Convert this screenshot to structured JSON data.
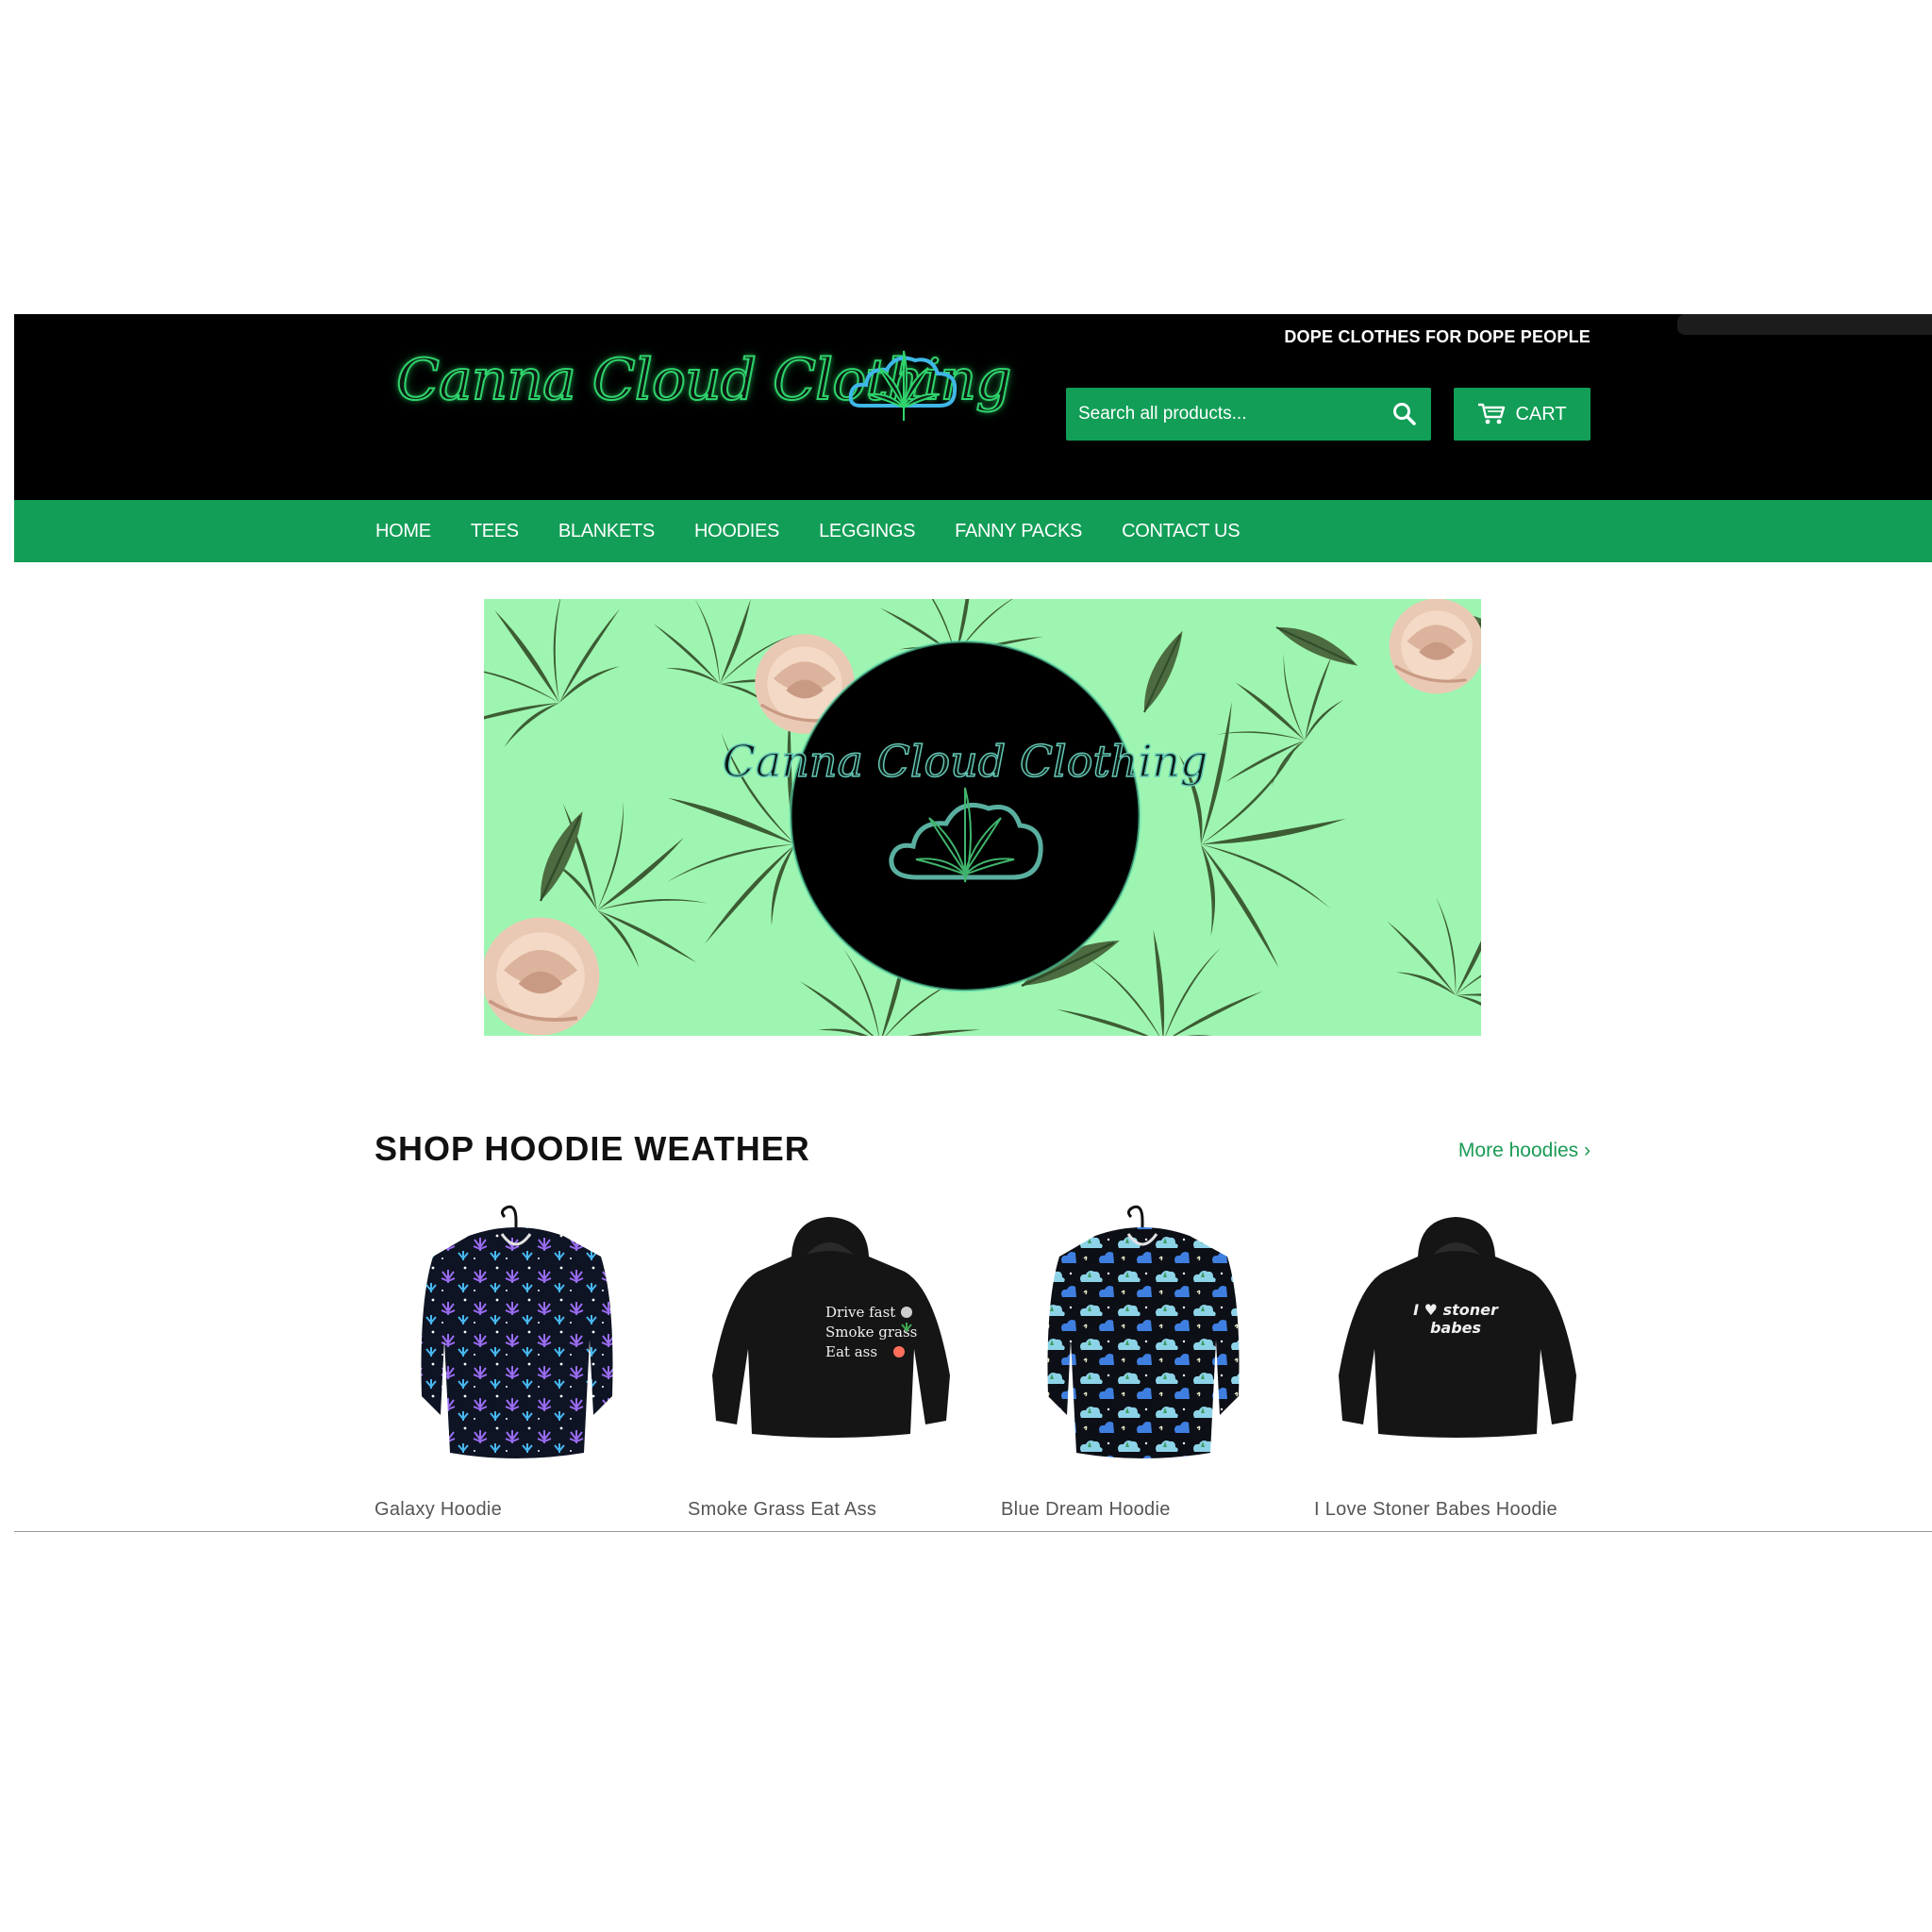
{
  "header": {
    "logo_text": "Canna Cloud Clothing",
    "tagline": "DOPE CLOTHES FOR DOPE PEOPLE",
    "search": {
      "placeholder": "Search all products..."
    },
    "cart_label": "CART"
  },
  "nav": {
    "items": [
      {
        "label": "HOME"
      },
      {
        "label": "TEES"
      },
      {
        "label": "BLANKETS"
      },
      {
        "label": "HOODIES"
      },
      {
        "label": "LEGGINGS"
      },
      {
        "label": "FANNY PACKS"
      },
      {
        "label": "CONTACT US"
      }
    ]
  },
  "hero": {
    "badge_text": "Canna Cloud Clothing"
  },
  "collection": {
    "title": "SHOP HOODIE WEATHER",
    "more_link": "More hoodies ›",
    "products": [
      {
        "name": "Galaxy Hoodie"
      },
      {
        "name": "Smoke Grass Eat Ass",
        "print": [
          "Drive fast",
          "Smoke grass",
          "Eat ass"
        ]
      },
      {
        "name": "Blue Dream Hoodie"
      },
      {
        "name": "I Love Stoner Babes Hoodie",
        "print": [
          "I ♥ stoner",
          "babes"
        ]
      }
    ]
  },
  "colors": {
    "header_bg": "#000000",
    "brand_green": "#129e57",
    "hero_bg": "#9ef5b1",
    "link_green": "#1a9b55"
  },
  "icons": [
    "leaf-cloud-icon",
    "search-icon",
    "cart-icon",
    "hanger-icon"
  ]
}
